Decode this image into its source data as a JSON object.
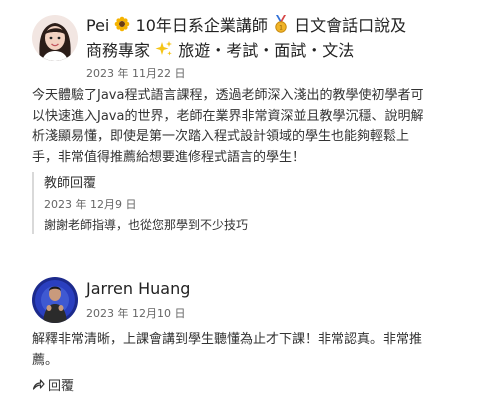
{
  "reviews": [
    {
      "author_line1": "Pei",
      "author_line1_rest": "10年日系企業講師",
      "author_line1_rest2": "日文會話口說及",
      "author_line2": "商務專家",
      "author_line2_rest": "旅遊・考試・面試・文法",
      "date": "2023 年 11月22 日",
      "body_lines": [
        "今天體驗了Java程式語言課程，透過老師深入淺出的教學使初學者可",
        "以快速進入Java的世界，老師在業界非常資深並且教學沉穩、說明解",
        "析淺顯易懂，即使是第一次踏入程式設計領域的學生也能夠輕鬆上",
        "手，非常值得推薦給想要進修程式語言的學生！"
      ],
      "teacher_reply": {
        "title": "教師回覆",
        "date": "2023 年 12月9 日",
        "text": "謝謝老師指導，也從您那學到不少技巧"
      },
      "icons": [
        "sunflower-emoji",
        "medal-emoji",
        "sparkles-emoji"
      ]
    },
    {
      "author": "Jarren Huang",
      "date": "2023 年 12月10 日",
      "body_lines": [
        "解釋非常清晰，上課會講到學生聽懂為止才下課！非常認真。非常推",
        "薦。"
      ],
      "reply_label": "回覆",
      "icons": [
        "reply-arrow-icon"
      ]
    }
  ],
  "colors": {
    "text": "#333333",
    "muted": "#666666",
    "quote_border": "#d9d9d9"
  }
}
